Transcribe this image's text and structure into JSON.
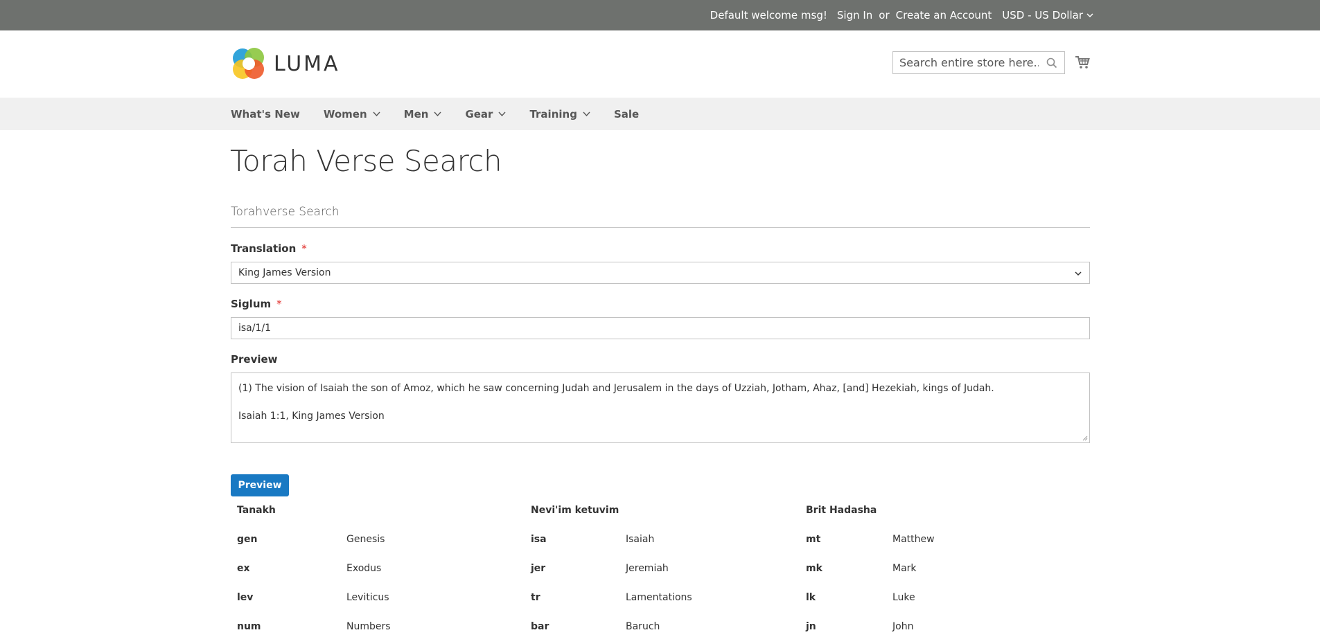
{
  "header": {
    "welcome": "Default welcome msg!",
    "sign_in": "Sign In",
    "or": "or",
    "create_account": "Create an Account",
    "currency": "USD - US Dollar"
  },
  "logo": {
    "text": "LUMA"
  },
  "search": {
    "placeholder": "Search entire store here..."
  },
  "nav": {
    "items": [
      {
        "label": "What's New"
      },
      {
        "label": "Women"
      },
      {
        "label": "Men"
      },
      {
        "label": "Gear"
      },
      {
        "label": "Training"
      },
      {
        "label": "Sale"
      }
    ]
  },
  "page": {
    "title": "Torah Verse Search"
  },
  "form": {
    "legend": "Torahverse Search",
    "translation_label": "Translation",
    "translation_value": "King James Version",
    "siglum_label": "Siglum",
    "siglum_value": "isa/1/1",
    "preview_label": "Preview",
    "preview_line1": "(1) The vision of Isaiah the son of Amoz, which he saw concerning Judah and Jerusalem in the days of Uzziah, Jotham, Ahaz, [and] Hezekiah, kings of Judah.",
    "preview_line2": "Isaiah 1:1, King James Version",
    "required_mark": "*",
    "preview_button": "Preview"
  },
  "books": {
    "tanakh": {
      "heading": "Tanakh",
      "rows": [
        {
          "abbr": "gen",
          "name": "Genesis"
        },
        {
          "abbr": "ex",
          "name": "Exodus"
        },
        {
          "abbr": "lev",
          "name": "Leviticus"
        },
        {
          "abbr": "num",
          "name": "Numbers"
        }
      ]
    },
    "neviim": {
      "heading": "Nevi'im ketuvim",
      "rows": [
        {
          "abbr": "isa",
          "name": "Isaiah"
        },
        {
          "abbr": "jer",
          "name": "Jeremiah"
        },
        {
          "abbr": "tr",
          "name": "Lamentations"
        },
        {
          "abbr": "bar",
          "name": "Baruch"
        }
      ]
    },
    "brit": {
      "heading": "Brit Hadasha",
      "rows": [
        {
          "abbr": "mt",
          "name": "Matthew"
        },
        {
          "abbr": "mk",
          "name": "Mark"
        },
        {
          "abbr": "lk",
          "name": "Luke"
        },
        {
          "abbr": "jn",
          "name": "John"
        }
      ]
    }
  },
  "colors": {
    "header_bg": "#6e716e",
    "nav_bg": "#f0f0f0",
    "button_blue": "#1979c3",
    "required_red": "#e02b27"
  },
  "icons": [
    "chevron-down-icon",
    "search-icon",
    "cart-icon",
    "luma-logo-icon"
  ]
}
